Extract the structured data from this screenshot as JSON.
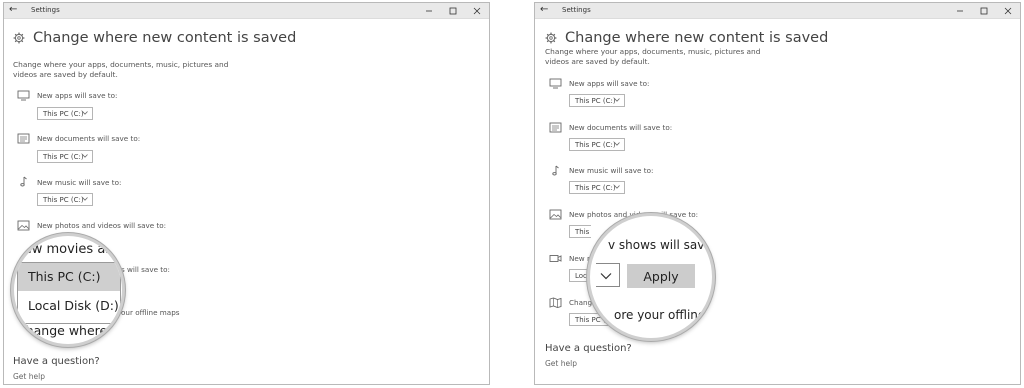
{
  "window": {
    "title": "Settings",
    "back_symbol": "←",
    "controls": [
      "minimize-icon",
      "maximize-icon",
      "close-icon"
    ]
  },
  "page": {
    "title": "Change where new content is saved",
    "description": "Change where your apps, documents, music, pictures and videos are saved by default."
  },
  "settings": [
    {
      "id": "apps",
      "label": "New apps will save to:",
      "value": "This PC (C:)",
      "icon": "monitor-icon"
    },
    {
      "id": "documents",
      "label": "New documents will save to:",
      "value": "This PC (C:)",
      "icon": "documents-icon"
    },
    {
      "id": "music",
      "label": "New music will save to:",
      "value": "This PC (C:)",
      "icon": "music-note-icon"
    },
    {
      "id": "photos",
      "label": "New photos and videos will save to:",
      "value": "This PC (C:)",
      "icon": "photo-icon"
    },
    {
      "id": "movies",
      "label": "New movies and TV shows will save to:",
      "value": "Local Disk (D:)",
      "icon": "video-icon"
    },
    {
      "id": "maps",
      "label": "Change where to store your offline maps",
      "value": "This PC (C:)",
      "icon": "map-icon"
    }
  ],
  "left_view": {
    "visible": {
      "movies_label_tail": "s will save to:",
      "maps_label_tail": "our offline maps"
    },
    "zoom": {
      "top_text": "New movies an",
      "options": [
        "This PC (C:)",
        "Local Disk (D:)"
      ],
      "selected_option": "This PC (C:)",
      "bottom_text": "Change where y"
    }
  },
  "right_view": {
    "visible": {
      "photos_label_fragment": "New photos and videos will save to:",
      "movies_label_fragment": "New movie",
      "movies_value_fragment": "Local Dis",
      "maps_label_fragment": "Change whe"
    },
    "zoom": {
      "top_text": "v shows will save to:",
      "apply_label": "Apply",
      "bottom_text": "ore your offline"
    }
  },
  "footer": {
    "question": "Have a question?",
    "help_link": "Get help"
  },
  "colors": {
    "titlebar": "#e9e9e9",
    "selected_option": "#cfcfcf",
    "apply_button": "#cccccc",
    "window_border": "#b9b9b9"
  }
}
